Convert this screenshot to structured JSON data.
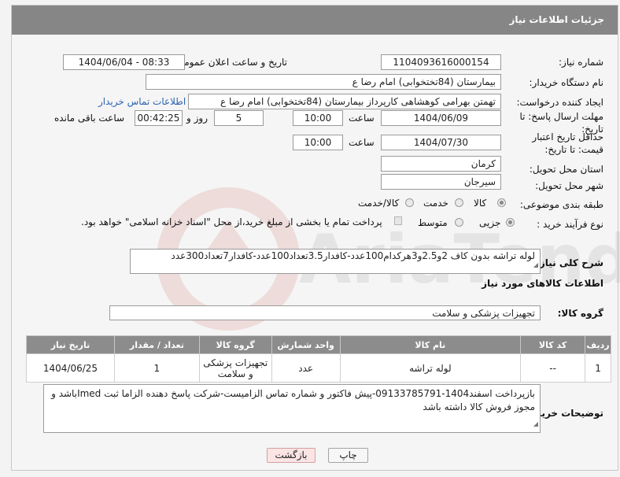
{
  "header": {
    "title": "جزئیات اطلاعات نیاز"
  },
  "fields": {
    "need_number": {
      "label": "شماره نیاز:",
      "value": "1104093616000154"
    },
    "announce_datetime": {
      "label": "تاریخ و ساعت اعلان عمومی:",
      "value": "1404/06/04 - 08:33"
    },
    "buyer_org": {
      "label": "نام دستگاه خریدار:",
      "value": "بیمارستان (84تختخوابی) امام رضا  ع"
    },
    "requester": {
      "label": "ایجاد کننده درخواست:",
      "value": "تهمتن بهرامی کوهشاهی کارپرداز بیمارستان (84تختخوابی) امام رضا  ع",
      "contact_link": "اطلاعات تماس خریدار"
    },
    "response_deadline": {
      "label": "مهلت ارسال پاسخ: تا تاریخ:",
      "date": "1404/06/09",
      "time_label": "ساعت",
      "time": "10:00",
      "days": "5",
      "days_label": "روز و",
      "remaining": "00:42:25",
      "remaining_label": "ساعت باقی مانده"
    },
    "price_validity": {
      "label": "حداقل تاریخ اعتبار قیمت: تا تاریخ:",
      "date": "1404/07/30",
      "time_label": "ساعت",
      "time": "10:00"
    },
    "province": {
      "label": "استان محل تحویل:",
      "value": "کرمان"
    },
    "city": {
      "label": "شهر محل تحویل:",
      "value": "سیرجان"
    },
    "category": {
      "label": "طبقه بندی موضوعی:",
      "options": [
        "کالا",
        "خدمت",
        "کالا/خدمت"
      ],
      "selected": "کالا"
    },
    "purchase_type": {
      "label": "نوع فرآیند خرید :",
      "options": [
        "جزیی",
        "متوسط"
      ],
      "selected": "جزیی",
      "note": "پرداخت تمام یا بخشی از مبلغ خرید،از محل \"اسناد خزانه اسلامی\" خواهد بود."
    },
    "description": {
      "label": "شرح کلی نیاز:",
      "value": "لوله تراشه بدون کاف 2و2.5و3هرکدام100عدد-کافدار3.5تعداد100عدد-کافدار7تعداد300عدد"
    }
  },
  "goods_section": {
    "title": "اطلاعات کالاهای مورد نیاز",
    "group_label": "گروه کالا:",
    "group_value": "تجهیزات پزشکی و سلامت"
  },
  "table": {
    "headers": [
      "ردیف",
      "کد کالا",
      "نام کالا",
      "واحد شمارش",
      "گروه کالا",
      "تعداد / مقدار",
      "تاریخ نیاز"
    ],
    "rows": [
      [
        "1",
        "--",
        "لوله تراشه",
        "عدد",
        "تجهیزات پزشکی و سلامت",
        "1",
        "1404/06/25"
      ]
    ]
  },
  "buyer_notes": {
    "label": "توضیحات خریدار:",
    "value": "بازپرداخت اسفند1404-09133785791-پیش فاکتور و شماره تماس الزامیست-شرکت پاسخ دهنده الزاما ثبت Imedباشد و مجوز فروش کالا داشته باشد"
  },
  "buttons": {
    "print": "چاپ",
    "back": "بازگشت"
  },
  "watermark": {
    "text": "AriaTender.net",
    "color": "#c0392b"
  }
}
